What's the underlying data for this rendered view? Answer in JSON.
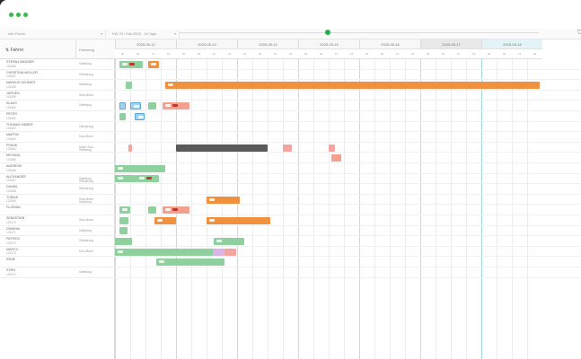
{
  "window": {
    "title": "",
    "dot_color": "#3bb84a"
  },
  "toolbar": {
    "select1": "Alle Fahrer",
    "select2": "KW 20 / Mai 2025 · 16 Tage",
    "icons": [
      "filter-icon",
      "settings-icon"
    ]
  },
  "left_header": {
    "col1": "Fahrer",
    "col2": "Fahrzeug"
  },
  "rows": [
    {
      "name": "STEFAN WAGNER",
      "sub": "123456",
      "type": "Sattelzug",
      "type2": ""
    },
    {
      "name": "CHRISTIAN MÜLLER",
      "sub": "123457",
      "type": "Gliederzug",
      "type2": ""
    },
    {
      "name": "MARKUS SCHMIDT",
      "sub": "123458",
      "type": "Sattelzug",
      "type2": ""
    },
    {
      "name": "JÜRGEN",
      "sub": "123459",
      "type": "Solo Motor",
      "type2": ""
    },
    {
      "name": "KLAUS",
      "sub": "123460",
      "type": "Sattelzug",
      "type2": ""
    },
    {
      "name": "PETER",
      "sub": "123461",
      "type": "",
      "type2": ""
    },
    {
      "name": "THOMAS WEBER",
      "sub": "123462",
      "type": "Gliederzug",
      "type2": ""
    },
    {
      "name": "MARTIN",
      "sub": "123463",
      "type": "Solo Motor",
      "type2": ""
    },
    {
      "name": "FRANK",
      "sub": "123464",
      "type": "Motor Solo",
      "type2": "Sattelzug"
    },
    {
      "name": "MICHAEL",
      "sub": "123465",
      "type": "",
      "type2": ""
    },
    {
      "name": "ANDREAS",
      "sub": "123466",
      "type": "",
      "type2": ""
    },
    {
      "name": "ALEXANDER",
      "sub": "123467",
      "type": "Sattelzug",
      "type2": "Gliederzug"
    },
    {
      "name": "DANIEL",
      "sub": "123468",
      "type": "Gliederzug",
      "type2": ""
    },
    {
      "name": "TOBIAS",
      "sub": "123469",
      "type": "Solo Motor",
      "type2": "Sattelzug"
    },
    {
      "name": "FLORIAN",
      "sub": "",
      "type": "",
      "type2": ""
    },
    {
      "name": "SEBASTIAN",
      "sub": "123470",
      "type": "Solo Motor",
      "type2": ""
    },
    {
      "name": "DOMINIK",
      "sub": "123471",
      "type": "Sattelzug",
      "type2": ""
    },
    {
      "name": "PATRICK",
      "sub": "123472",
      "type": "Gliederzug",
      "type2": ""
    },
    {
      "name": "MARCO",
      "sub": "123473",
      "type": "Solo Motor",
      "type2": ""
    },
    {
      "name": "RENE",
      "sub": "",
      "type": "",
      "type2": ""
    },
    {
      "name": "SVEN",
      "sub": "123474",
      "type": "Sattelzug",
      "type2": ""
    }
  ],
  "days": [
    {
      "label": "2025-05-12",
      "kind": "normal"
    },
    {
      "label": "2025-05-13",
      "kind": "normal"
    },
    {
      "label": "2025-05-14",
      "kind": "normal"
    },
    {
      "label": "2025-05-15",
      "kind": "normal"
    },
    {
      "label": "2025-05-16",
      "kind": "normal"
    },
    {
      "label": "2025-05-17",
      "kind": "weekend"
    },
    {
      "label": "2025-05-18",
      "kind": "today"
    }
  ],
  "ticks": [
    "00",
    "06",
    "12",
    "18"
  ],
  "bars": [
    {
      "row": 0,
      "start": 0.08,
      "end": 0.45,
      "color": "green",
      "icons": 2
    },
    {
      "row": 0,
      "start": 0.55,
      "end": 0.72,
      "color": "orange",
      "icons": 1
    },
    {
      "row": 2,
      "start": 0.18,
      "end": 0.28,
      "color": "green",
      "icons": 0
    },
    {
      "row": 2,
      "start": 0.82,
      "end": 6.95,
      "color": "orange",
      "icons": 1
    },
    {
      "row": 4,
      "start": 0.07,
      "end": 0.18,
      "color": "blue",
      "icons": 0
    },
    {
      "row": 4,
      "start": 0.25,
      "end": 0.42,
      "color": "blue",
      "icons": 1
    },
    {
      "row": 4,
      "start": 0.55,
      "end": 0.67,
      "color": "green",
      "icons": 0
    },
    {
      "row": 4,
      "start": 0.78,
      "end": 1.22,
      "color": "salmon",
      "icons": 2
    },
    {
      "row": 5,
      "start": 0.07,
      "end": 0.18,
      "color": "green",
      "icons": 0
    },
    {
      "row": 5,
      "start": 0.33,
      "end": 0.48,
      "color": "blue",
      "icons": 1
    },
    {
      "row": 8,
      "start": 0.22,
      "end": 0.28,
      "color": "pink",
      "icons": 0
    },
    {
      "row": 8,
      "start": 1.0,
      "end": 2.5,
      "color": "dark",
      "icons": 0
    },
    {
      "row": 8,
      "start": 2.75,
      "end": 2.9,
      "color": "pink",
      "icons": 0
    },
    {
      "row": 8,
      "start": 3.5,
      "end": 3.6,
      "color": "pink",
      "icons": 0
    },
    {
      "row": 9,
      "start": 3.55,
      "end": 3.7,
      "color": "salmon",
      "icons": 0
    },
    {
      "row": 10,
      "start": 0.0,
      "end": 0.82,
      "color": "green",
      "icons": 1
    },
    {
      "row": 11,
      "start": 0.0,
      "end": 0.35,
      "color": "green",
      "icons": 1
    },
    {
      "row": 11,
      "start": 0.35,
      "end": 0.72,
      "color": "green",
      "icons": 2
    },
    {
      "row": 13,
      "start": 1.5,
      "end": 2.05,
      "color": "orange",
      "icons": 1
    },
    {
      "row": 14,
      "start": 0.07,
      "end": 0.25,
      "color": "green",
      "icons": 1
    },
    {
      "row": 14,
      "start": 0.55,
      "end": 0.67,
      "color": "green",
      "icons": 0
    },
    {
      "row": 14,
      "start": 0.78,
      "end": 1.22,
      "color": "salmon",
      "icons": 2
    },
    {
      "row": 15,
      "start": 0.07,
      "end": 0.22,
      "color": "green",
      "icons": 0
    },
    {
      "row": 15,
      "start": 0.65,
      "end": 1.0,
      "color": "orange",
      "icons": 1
    },
    {
      "row": 15,
      "start": 1.5,
      "end": 2.55,
      "color": "orange",
      "icons": 1
    },
    {
      "row": 16,
      "start": 0.07,
      "end": 0.2,
      "color": "green",
      "icons": 0
    },
    {
      "row": 17,
      "start": 0.0,
      "end": 0.28,
      "color": "green",
      "icons": 0
    },
    {
      "row": 17,
      "start": 1.62,
      "end": 2.12,
      "color": "green",
      "icons": 1
    },
    {
      "row": 18,
      "start": 0.0,
      "end": 1.8,
      "color": "lavender",
      "icons": 0
    },
    {
      "row": 18,
      "start": 0.0,
      "end": 1.6,
      "color": "green",
      "icons": 1
    },
    {
      "row": 18,
      "start": 1.8,
      "end": 1.98,
      "color": "pink",
      "icons": 0
    },
    {
      "row": 19,
      "start": 0.68,
      "end": 1.8,
      "color": "green",
      "icons": 1
    }
  ]
}
